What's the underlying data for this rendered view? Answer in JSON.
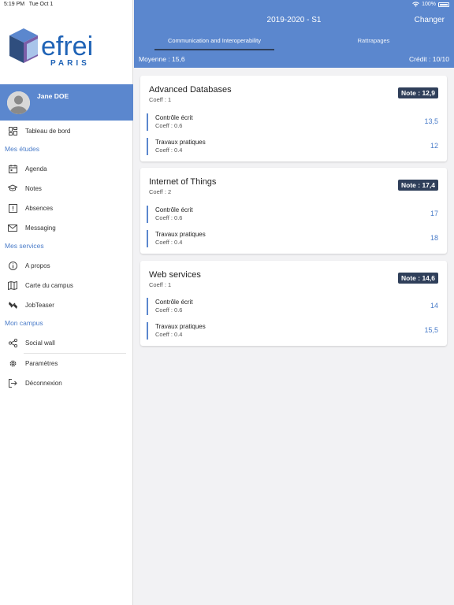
{
  "status_bar": {
    "time": "5:19 PM",
    "date": "Tue Oct 1",
    "battery": "100%",
    "wifi_icon": "wifi-icon"
  },
  "logo": {
    "brand": "efrei",
    "city": "PARIS"
  },
  "profile": {
    "name": "Jane DOE"
  },
  "menu": {
    "dashboard": "Tableau de bord",
    "section_studies": "Mes études",
    "agenda": "Agenda",
    "notes": "Notes",
    "absences": "Absences",
    "messaging": "Messaging",
    "section_services": "Mes services",
    "about": "A propos",
    "campus_map": "Carte du campus",
    "jobteaser": "JobTeaser",
    "section_campus": "Mon campus",
    "social_wall": "Social wall",
    "settings": "Paramètres",
    "logout": "Déconnexion"
  },
  "header": {
    "title": "2019-2020 - S1",
    "change": "Changer",
    "tabs": [
      "Communication and Interoperability",
      "Rattrapages"
    ],
    "average": "Moyenne : 15,6",
    "credits": "Crédit : 10/10"
  },
  "courses": [
    {
      "name": "Advanced Databases",
      "coeff": "Coeff : 1",
      "note": "Note : 12,9",
      "items": [
        {
          "name": "Contrôle écrit",
          "coeff": "Coeff : 0.6",
          "value": "13,5"
        },
        {
          "name": "Travaux pratiques",
          "coeff": "Coeff : 0.4",
          "value": "12"
        }
      ]
    },
    {
      "name": "Internet of Things",
      "coeff": "Coeff : 2",
      "note": "Note : 17,4",
      "items": [
        {
          "name": "Contrôle écrit",
          "coeff": "Coeff : 0.6",
          "value": "17"
        },
        {
          "name": "Travaux pratiques",
          "coeff": "Coeff : 0.4",
          "value": "18"
        }
      ]
    },
    {
      "name": "Web services",
      "coeff": "Coeff : 1",
      "note": "Note : 14,6",
      "items": [
        {
          "name": "Contrôle écrit",
          "coeff": "Coeff : 0.6",
          "value": "14"
        },
        {
          "name": "Travaux pratiques",
          "coeff": "Coeff : 0.4",
          "value": "15,5"
        }
      ]
    }
  ],
  "colors": {
    "accent": "#5b87ce",
    "badge": "#2f3f5a",
    "link": "#4a7cc9"
  }
}
